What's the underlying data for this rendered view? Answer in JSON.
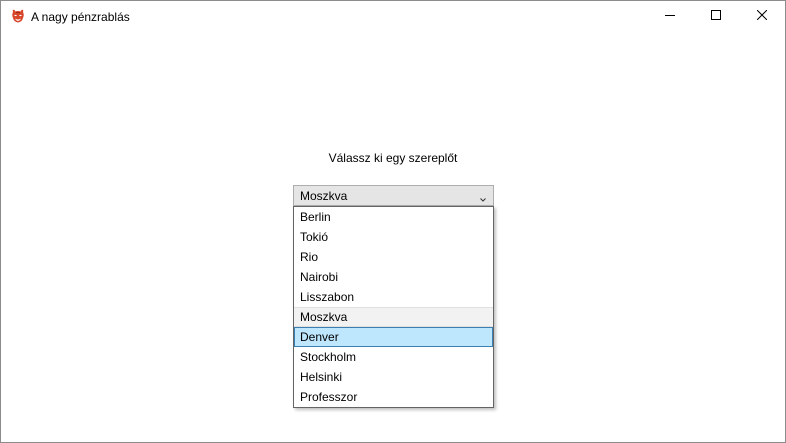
{
  "window": {
    "title": "A nagy pénzrablás",
    "icon": "mask-icon",
    "controls": {
      "minimize": "minimize-icon",
      "maximize": "maximize-icon",
      "close": "close-icon"
    }
  },
  "main": {
    "prompt": "Válassz ki egy szereplőt",
    "combo": {
      "selected_value": "Moszkva",
      "arrow_icon": "chevron-down-icon"
    },
    "dropdown": {
      "items": [
        {
          "label": "Berlin"
        },
        {
          "label": "Tokió"
        },
        {
          "label": "Rio"
        },
        {
          "label": "Nairobi"
        },
        {
          "label": "Lisszabon"
        },
        {
          "label": "Moszkva"
        },
        {
          "label": "Denver"
        },
        {
          "label": "Stockholm"
        },
        {
          "label": "Helsinki"
        },
        {
          "label": "Professzor"
        }
      ],
      "selected_label": "Moszkva",
      "hovered_label": "Denver"
    }
  },
  "colors": {
    "hover_fill": "#bee6fd",
    "hover_border": "#3c7fb1",
    "selected_fill": "#f2f2f2"
  }
}
